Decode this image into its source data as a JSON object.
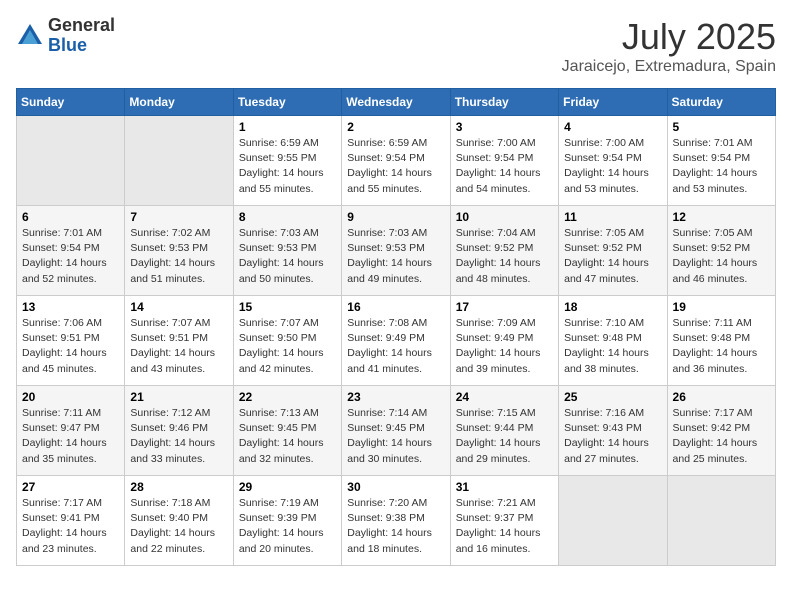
{
  "header": {
    "logo_general": "General",
    "logo_blue": "Blue",
    "month": "July 2025",
    "location": "Jaraicejo, Extremadura, Spain"
  },
  "weekdays": [
    "Sunday",
    "Monday",
    "Tuesday",
    "Wednesday",
    "Thursday",
    "Friday",
    "Saturday"
  ],
  "weeks": [
    [
      {
        "day": null
      },
      {
        "day": null
      },
      {
        "day": "1",
        "sunrise": "Sunrise: 6:59 AM",
        "sunset": "Sunset: 9:55 PM",
        "daylight": "Daylight: 14 hours and 55 minutes."
      },
      {
        "day": "2",
        "sunrise": "Sunrise: 6:59 AM",
        "sunset": "Sunset: 9:54 PM",
        "daylight": "Daylight: 14 hours and 55 minutes."
      },
      {
        "day": "3",
        "sunrise": "Sunrise: 7:00 AM",
        "sunset": "Sunset: 9:54 PM",
        "daylight": "Daylight: 14 hours and 54 minutes."
      },
      {
        "day": "4",
        "sunrise": "Sunrise: 7:00 AM",
        "sunset": "Sunset: 9:54 PM",
        "daylight": "Daylight: 14 hours and 53 minutes."
      },
      {
        "day": "5",
        "sunrise": "Sunrise: 7:01 AM",
        "sunset": "Sunset: 9:54 PM",
        "daylight": "Daylight: 14 hours and 53 minutes."
      }
    ],
    [
      {
        "day": "6",
        "sunrise": "Sunrise: 7:01 AM",
        "sunset": "Sunset: 9:54 PM",
        "daylight": "Daylight: 14 hours and 52 minutes."
      },
      {
        "day": "7",
        "sunrise": "Sunrise: 7:02 AM",
        "sunset": "Sunset: 9:53 PM",
        "daylight": "Daylight: 14 hours and 51 minutes."
      },
      {
        "day": "8",
        "sunrise": "Sunrise: 7:03 AM",
        "sunset": "Sunset: 9:53 PM",
        "daylight": "Daylight: 14 hours and 50 minutes."
      },
      {
        "day": "9",
        "sunrise": "Sunrise: 7:03 AM",
        "sunset": "Sunset: 9:53 PM",
        "daylight": "Daylight: 14 hours and 49 minutes."
      },
      {
        "day": "10",
        "sunrise": "Sunrise: 7:04 AM",
        "sunset": "Sunset: 9:52 PM",
        "daylight": "Daylight: 14 hours and 48 minutes."
      },
      {
        "day": "11",
        "sunrise": "Sunrise: 7:05 AM",
        "sunset": "Sunset: 9:52 PM",
        "daylight": "Daylight: 14 hours and 47 minutes."
      },
      {
        "day": "12",
        "sunrise": "Sunrise: 7:05 AM",
        "sunset": "Sunset: 9:52 PM",
        "daylight": "Daylight: 14 hours and 46 minutes."
      }
    ],
    [
      {
        "day": "13",
        "sunrise": "Sunrise: 7:06 AM",
        "sunset": "Sunset: 9:51 PM",
        "daylight": "Daylight: 14 hours and 45 minutes."
      },
      {
        "day": "14",
        "sunrise": "Sunrise: 7:07 AM",
        "sunset": "Sunset: 9:51 PM",
        "daylight": "Daylight: 14 hours and 43 minutes."
      },
      {
        "day": "15",
        "sunrise": "Sunrise: 7:07 AM",
        "sunset": "Sunset: 9:50 PM",
        "daylight": "Daylight: 14 hours and 42 minutes."
      },
      {
        "day": "16",
        "sunrise": "Sunrise: 7:08 AM",
        "sunset": "Sunset: 9:49 PM",
        "daylight": "Daylight: 14 hours and 41 minutes."
      },
      {
        "day": "17",
        "sunrise": "Sunrise: 7:09 AM",
        "sunset": "Sunset: 9:49 PM",
        "daylight": "Daylight: 14 hours and 39 minutes."
      },
      {
        "day": "18",
        "sunrise": "Sunrise: 7:10 AM",
        "sunset": "Sunset: 9:48 PM",
        "daylight": "Daylight: 14 hours and 38 minutes."
      },
      {
        "day": "19",
        "sunrise": "Sunrise: 7:11 AM",
        "sunset": "Sunset: 9:48 PM",
        "daylight": "Daylight: 14 hours and 36 minutes."
      }
    ],
    [
      {
        "day": "20",
        "sunrise": "Sunrise: 7:11 AM",
        "sunset": "Sunset: 9:47 PM",
        "daylight": "Daylight: 14 hours and 35 minutes."
      },
      {
        "day": "21",
        "sunrise": "Sunrise: 7:12 AM",
        "sunset": "Sunset: 9:46 PM",
        "daylight": "Daylight: 14 hours and 33 minutes."
      },
      {
        "day": "22",
        "sunrise": "Sunrise: 7:13 AM",
        "sunset": "Sunset: 9:45 PM",
        "daylight": "Daylight: 14 hours and 32 minutes."
      },
      {
        "day": "23",
        "sunrise": "Sunrise: 7:14 AM",
        "sunset": "Sunset: 9:45 PM",
        "daylight": "Daylight: 14 hours and 30 minutes."
      },
      {
        "day": "24",
        "sunrise": "Sunrise: 7:15 AM",
        "sunset": "Sunset: 9:44 PM",
        "daylight": "Daylight: 14 hours and 29 minutes."
      },
      {
        "day": "25",
        "sunrise": "Sunrise: 7:16 AM",
        "sunset": "Sunset: 9:43 PM",
        "daylight": "Daylight: 14 hours and 27 minutes."
      },
      {
        "day": "26",
        "sunrise": "Sunrise: 7:17 AM",
        "sunset": "Sunset: 9:42 PM",
        "daylight": "Daylight: 14 hours and 25 minutes."
      }
    ],
    [
      {
        "day": "27",
        "sunrise": "Sunrise: 7:17 AM",
        "sunset": "Sunset: 9:41 PM",
        "daylight": "Daylight: 14 hours and 23 minutes."
      },
      {
        "day": "28",
        "sunrise": "Sunrise: 7:18 AM",
        "sunset": "Sunset: 9:40 PM",
        "daylight": "Daylight: 14 hours and 22 minutes."
      },
      {
        "day": "29",
        "sunrise": "Sunrise: 7:19 AM",
        "sunset": "Sunset: 9:39 PM",
        "daylight": "Daylight: 14 hours and 20 minutes."
      },
      {
        "day": "30",
        "sunrise": "Sunrise: 7:20 AM",
        "sunset": "Sunset: 9:38 PM",
        "daylight": "Daylight: 14 hours and 18 minutes."
      },
      {
        "day": "31",
        "sunrise": "Sunrise: 7:21 AM",
        "sunset": "Sunset: 9:37 PM",
        "daylight": "Daylight: 14 hours and 16 minutes."
      },
      {
        "day": null
      },
      {
        "day": null
      }
    ]
  ]
}
